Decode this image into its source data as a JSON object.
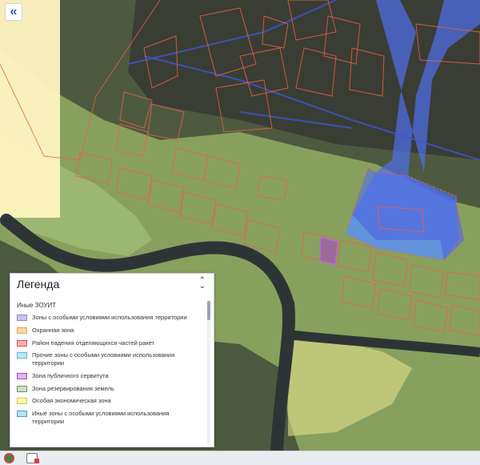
{
  "map": {
    "colors": {
      "imagery": "#4a5a3e",
      "green_zone": "#9cb86a",
      "yellow_zone": "#fff6c2",
      "blue_zone": "#4f6ff0",
      "parcel_outline": "#e8604a",
      "river": "#2e3436",
      "servitude": "#a24bc0"
    }
  },
  "controls": {
    "collapse_label": "«"
  },
  "legend": {
    "title": "Легенда",
    "close_icon": "chevron-up-down-icon",
    "group_label": "Иные ЗОУИТ",
    "items": [
      {
        "label": "Зоны с особыми условиями использования территории",
        "fill": "#c9c7f0",
        "stroke": "#8b87d8"
      },
      {
        "label": "Охранная зона",
        "fill": "#f9d9a8",
        "stroke": "#e8a85a"
      },
      {
        "label": "Район падения отделяющихся частей ракет",
        "fill": "#f7b4b4",
        "stroke": "#d94a4a"
      },
      {
        "label": "Прочие зоны с особыми условиями использования территории",
        "fill": "#bfe6f7",
        "stroke": "#5fb3d9"
      },
      {
        "label": "Зона публичного сервитута",
        "fill": "#e0b3f0",
        "stroke": "#a24bc0"
      },
      {
        "label": "Зона резервирования земель",
        "fill": "#cfe0c8",
        "stroke": "#6f8f60"
      },
      {
        "label": "Особая экономическая зона",
        "fill": "#fdf6b0",
        "stroke": "#d8c84a"
      },
      {
        "label": "Иные зоны с особыми условиями использования территории",
        "fill": "#b8e2f2",
        "stroke": "#4aa3cc"
      }
    ]
  }
}
